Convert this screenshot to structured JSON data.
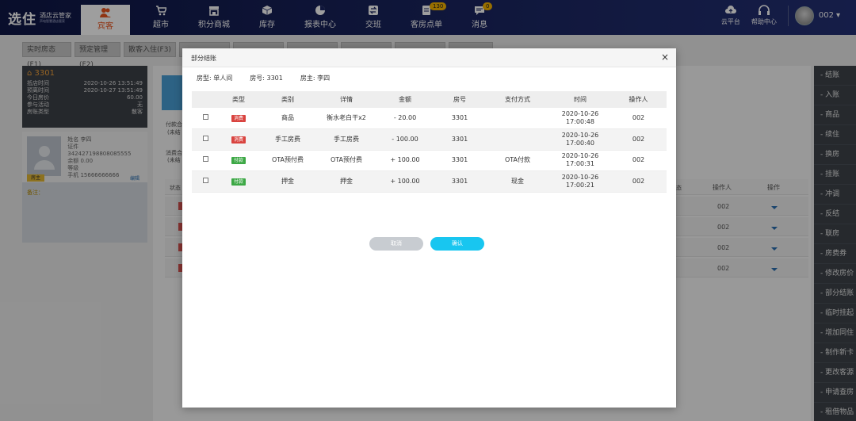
{
  "logo": {
    "main": "选住",
    "line1": "酒店云管家",
    "line2": "声电智慧酒店管家"
  },
  "nav": [
    {
      "label": "宾客",
      "icon": "guests-icon",
      "active": true
    },
    {
      "label": "超市",
      "icon": "cart-icon"
    },
    {
      "label": "积分商城",
      "icon": "shop-icon"
    },
    {
      "label": "库存",
      "icon": "box-icon"
    },
    {
      "label": "报表中心",
      "icon": "pie-chart-icon"
    },
    {
      "label": "交班",
      "icon": "handover-icon"
    },
    {
      "label": "客房点单",
      "icon": "order-icon",
      "badge": "130"
    },
    {
      "label": "消息",
      "icon": "message-icon",
      "badge": "0"
    }
  ],
  "top_right": {
    "cloud": "云平台",
    "help": "帮助中心",
    "user": "002"
  },
  "tabs": [
    "实时房态(F1)",
    "预定管理(F2)",
    "散客入住(F3)",
    "",
    "",
    "",
    "",
    "",
    ""
  ],
  "room": {
    "number": "3301",
    "rows": [
      {
        "k": "抵店时间",
        "v": "2020-10-26 13:51:49"
      },
      {
        "k": "预离时间",
        "v": "2020-10-27 13:51:49"
      },
      {
        "k": "今日房价",
        "v": "60.00"
      },
      {
        "k": "参与活动",
        "v": "无"
      },
      {
        "k": "房账类型",
        "v": "散客"
      }
    ]
  },
  "guest": {
    "lines": [
      "姓名  李四",
      "证件  342427198808085555",
      "余额  0.00",
      "等级",
      "手机  15666666666"
    ],
    "master_label": "房主",
    "edit": "编辑",
    "note": "备注："
  },
  "background": {
    "pay_label": "付款合",
    "pay_sub": "(未结",
    "consume_label": "消费合",
    "consume_sub": "(未结",
    "status_label": "状态",
    "col_state": "态",
    "col_operator": "操作人",
    "col_action": "操作",
    "operator_values": [
      "002",
      "002",
      "002",
      "002"
    ]
  },
  "right_menu": [
    "结账",
    "入账",
    "商品",
    "续住",
    "换房",
    "挂账",
    "冲调",
    "反结",
    "联房",
    "房费券",
    "修改房价",
    "部分结账",
    "临时挂起",
    "增加同住",
    "制作新卡",
    "更改客源",
    "申请查房",
    "租借物品"
  ],
  "modal": {
    "title": "部分结账",
    "close": "×",
    "info": {
      "room_type": "房型: 单人间",
      "room_no": "房号: 3301",
      "owner": "房主: 李四"
    },
    "headers": [
      "",
      "类型",
      "类别",
      "详情",
      "金额",
      "房号",
      "支付方式",
      "时间",
      "操作人"
    ],
    "rows": [
      {
        "type": "消费",
        "type_color": "red",
        "category": "商品",
        "detail": "衡水老白干x2",
        "amount": "- 20.00",
        "room": "3301",
        "pay": "",
        "date": "2020-10-26",
        "time": "17:00:48",
        "operator": "002"
      },
      {
        "type": "消费",
        "type_color": "red",
        "category": "手工房费",
        "detail": "手工房费",
        "amount": "- 100.00",
        "room": "3301",
        "pay": "",
        "date": "2020-10-26",
        "time": "17:00:40",
        "operator": "002"
      },
      {
        "type": "付款",
        "type_color": "green",
        "category": "OTA预付费",
        "detail": "OTA预付费",
        "amount": "+ 100.00",
        "room": "3301",
        "pay": "OTA付款",
        "date": "2020-10-26",
        "time": "17:00:31",
        "operator": "002"
      },
      {
        "type": "付款",
        "type_color": "green",
        "category": "押金",
        "detail": "押金",
        "amount": "+ 100.00",
        "room": "3301",
        "pay": "现金",
        "date": "2020-10-26",
        "time": "17:00:21",
        "operator": "002"
      }
    ],
    "cancel": "取消",
    "confirm": "确认"
  },
  "colors": {
    "nav_bg": "#1a2560",
    "accent_orange": "#e8541f",
    "confirm_blue": "#18c6f0",
    "tag_red": "#d9433f",
    "tag_green": "#3ca845"
  }
}
